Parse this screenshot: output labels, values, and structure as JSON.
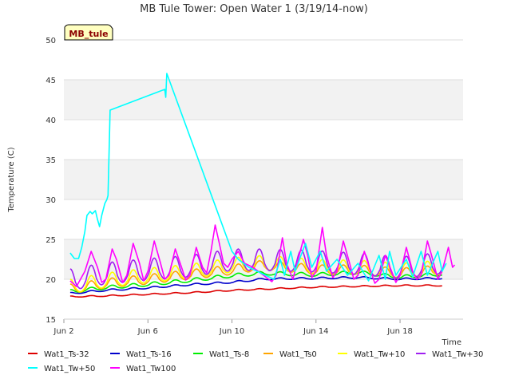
{
  "chart_data": {
    "type": "line",
    "title": "MB Tule Tower: Open Water 1 (3/19/14-now)",
    "xlabel": "Time",
    "ylabel": "Temperature (C)",
    "site_label": "MB_tule",
    "ylim": [
      15,
      50
    ],
    "xlim": [
      0,
      19
    ],
    "yticks": [
      15,
      20,
      25,
      30,
      35,
      40,
      45,
      50
    ],
    "xticks": [
      {
        "label": "Jun 2",
        "day": 0
      },
      {
        "label": "Jun 6",
        "day": 4
      },
      {
        "label": "Jun 10",
        "day": 8
      },
      {
        "label": "Jun 14",
        "day": 12
      },
      {
        "label": "Jun 18",
        "day": 16
      }
    ],
    "grid": true,
    "legend_position": "bottom",
    "series": [
      {
        "name": "Wat1_Ts-32",
        "color": "#dd0000",
        "base": [
          [
            0.3,
            17.8
          ],
          [
            2,
            17.9
          ],
          [
            4,
            18.1
          ],
          [
            6,
            18.3
          ],
          [
            8,
            18.6
          ],
          [
            10,
            18.8
          ],
          [
            12,
            19.0
          ],
          [
            14,
            19.1
          ],
          [
            16,
            19.2
          ],
          [
            18,
            19.2
          ]
        ],
        "amp": 0.1
      },
      {
        "name": "Wat1_Ts-16",
        "color": "#0000cc",
        "base": [
          [
            0.3,
            18.2
          ],
          [
            2,
            18.6
          ],
          [
            4,
            18.9
          ],
          [
            6,
            19.3
          ],
          [
            8,
            19.6
          ],
          [
            9.5,
            20.0
          ],
          [
            12,
            20.1
          ],
          [
            14,
            20.2
          ],
          [
            16,
            20.0
          ],
          [
            18,
            20.1
          ]
        ],
        "amp": 0.15
      },
      {
        "name": "Wat1_Ts-8",
        "color": "#00ee00",
        "base": [
          [
            0.3,
            18.4
          ],
          [
            2,
            18.9
          ],
          [
            4,
            19.3
          ],
          [
            6,
            19.8
          ],
          [
            8,
            20.4
          ],
          [
            9.5,
            20.7
          ],
          [
            12,
            20.5
          ],
          [
            14,
            20.8
          ],
          [
            16,
            20.2
          ],
          [
            18,
            20.6
          ]
        ],
        "amp": 0.3
      },
      {
        "name": "Wat1_Ts0",
        "color": "#ffa500",
        "base": [
          [
            0.3,
            18.6
          ],
          [
            2,
            19.3
          ],
          [
            4,
            19.8
          ],
          [
            6,
            20.4
          ],
          [
            8,
            21.0
          ],
          [
            9.5,
            21.6
          ],
          [
            12,
            21.0
          ],
          [
            14,
            21.0
          ],
          [
            16,
            20.6
          ],
          [
            18,
            21.0
          ]
        ],
        "amp": 0.8
      },
      {
        "name": "Wat1_Tw+10",
        "color": "#ffff00",
        "base": [
          [
            0.3,
            18.8
          ],
          [
            2,
            19.6
          ],
          [
            4,
            20.2
          ],
          [
            6,
            20.7
          ],
          [
            8,
            21.5
          ],
          [
            9.5,
            21.8
          ],
          [
            12,
            21.3
          ],
          [
            14,
            21.2
          ],
          [
            16,
            20.8
          ],
          [
            18,
            21.2
          ]
        ],
        "amp": 1.2
      },
      {
        "name": "Wat1_Tw+30",
        "color": "#a020f0",
        "base": [
          [
            0.3,
            19.5
          ],
          [
            2,
            20.3
          ],
          [
            4,
            20.8
          ],
          [
            6,
            21.2
          ],
          [
            8,
            22.0
          ],
          [
            9.5,
            22.0
          ],
          [
            12,
            21.8
          ],
          [
            14,
            21.5
          ],
          [
            16,
            21.0
          ],
          [
            18,
            21.6
          ]
        ],
        "amp": 1.8
      },
      {
        "name": "Wat1_Tw+50",
        "color": "#00ffff",
        "points": [
          [
            0.3,
            23.3
          ],
          [
            0.5,
            22.6
          ],
          [
            0.7,
            22.6
          ],
          [
            0.85,
            24.0
          ],
          [
            1.0,
            26.0
          ],
          [
            1.1,
            28.0
          ],
          [
            1.25,
            28.5
          ],
          [
            1.35,
            28.2
          ],
          [
            1.5,
            28.6
          ],
          [
            1.6,
            27.5
          ],
          [
            1.7,
            26.6
          ],
          [
            1.8,
            28.0
          ],
          [
            1.95,
            29.5
          ],
          [
            2.05,
            30.0
          ],
          [
            2.1,
            30.5
          ],
          [
            2.2,
            41.2
          ],
          [
            4.8,
            43.8
          ],
          [
            4.85,
            42.8
          ],
          [
            4.9,
            45.8
          ],
          [
            8.0,
            23.5
          ],
          [
            8.3,
            22.5
          ],
          [
            8.8,
            21.5
          ],
          [
            9.2,
            21.0
          ],
          [
            9.6,
            20.5
          ],
          [
            10,
            20.0
          ],
          [
            10.3,
            22.5
          ],
          [
            10.5,
            20.5
          ],
          [
            10.8,
            23.5
          ],
          [
            11,
            21.0
          ],
          [
            11.5,
            24.5
          ],
          [
            11.8,
            21.5
          ],
          [
            12.2,
            23.5
          ],
          [
            12.5,
            21.0
          ],
          [
            13,
            22.5
          ],
          [
            13.5,
            20.5
          ],
          [
            14,
            22.0
          ],
          [
            14.5,
            19.8
          ],
          [
            15,
            23.0
          ],
          [
            15.3,
            20.0
          ],
          [
            15.5,
            23.5
          ],
          [
            15.8,
            20.5
          ],
          [
            16.3,
            22.5
          ],
          [
            16.6,
            20.3
          ],
          [
            17,
            23.5
          ],
          [
            17.3,
            20.5
          ],
          [
            17.8,
            23.5
          ],
          [
            18.0,
            21.0
          ],
          [
            18.2,
            22.0
          ]
        ]
      },
      {
        "name": "Wat1_Tw100",
        "color": "#ff00ff",
        "points": [
          [
            0.3,
            19.8
          ],
          [
            0.6,
            19.1
          ],
          [
            1.0,
            21.0
          ],
          [
            1.3,
            23.5
          ],
          [
            1.6,
            21.5
          ],
          [
            1.8,
            19.6
          ],
          [
            2.0,
            20.0
          ],
          [
            2.3,
            23.8
          ],
          [
            2.5,
            22.5
          ],
          [
            2.8,
            19.6
          ],
          [
            3.0,
            20.5
          ],
          [
            3.3,
            24.5
          ],
          [
            3.6,
            22.0
          ],
          [
            3.8,
            19.8
          ],
          [
            4.0,
            21.0
          ],
          [
            4.3,
            24.8
          ],
          [
            4.6,
            22.0
          ],
          [
            4.8,
            20.0
          ],
          [
            5.0,
            20.5
          ],
          [
            5.3,
            23.8
          ],
          [
            5.6,
            21.5
          ],
          [
            5.8,
            19.9
          ],
          [
            6.0,
            20.5
          ],
          [
            6.3,
            24.0
          ],
          [
            6.6,
            21.5
          ],
          [
            6.8,
            20.8
          ],
          [
            7.0,
            23.5
          ],
          [
            7.2,
            26.8
          ],
          [
            7.4,
            24.5
          ],
          [
            7.6,
            22.0
          ],
          [
            7.8,
            21.5
          ],
          [
            8.0,
            22.5
          ],
          [
            8.3,
            23.5
          ],
          [
            8.6,
            22.0
          ],
          [
            9.0,
            21.5
          ],
          [
            9.5,
            20.5
          ],
          [
            9.9,
            19.7
          ],
          [
            10.1,
            20.5
          ],
          [
            10.4,
            25.2
          ],
          [
            10.6,
            22.0
          ],
          [
            10.9,
            20.0
          ],
          [
            11.1,
            22.0
          ],
          [
            11.4,
            25.0
          ],
          [
            11.6,
            23.0
          ],
          [
            11.8,
            20.2
          ],
          [
            12.0,
            21.0
          ],
          [
            12.3,
            26.5
          ],
          [
            12.5,
            23.0
          ],
          [
            12.8,
            20.2
          ],
          [
            13.0,
            21.0
          ],
          [
            13.3,
            24.8
          ],
          [
            13.6,
            22.0
          ],
          [
            13.8,
            20.0
          ],
          [
            14.0,
            20.5
          ],
          [
            14.3,
            23.5
          ],
          [
            14.6,
            21.0
          ],
          [
            14.8,
            19.5
          ],
          [
            15.0,
            20.0
          ],
          [
            15.3,
            23.0
          ],
          [
            15.6,
            21.0
          ],
          [
            15.8,
            19.6
          ],
          [
            16.0,
            20.5
          ],
          [
            16.3,
            24.0
          ],
          [
            16.6,
            21.0
          ],
          [
            16.8,
            20.0
          ],
          [
            17.0,
            20.5
          ],
          [
            17.3,
            24.8
          ],
          [
            17.5,
            23.0
          ],
          [
            17.8,
            20.0
          ],
          [
            18.0,
            21.0
          ],
          [
            18.3,
            24.0
          ],
          [
            18.5,
            21.5
          ],
          [
            18.6,
            21.8
          ]
        ]
      }
    ]
  }
}
